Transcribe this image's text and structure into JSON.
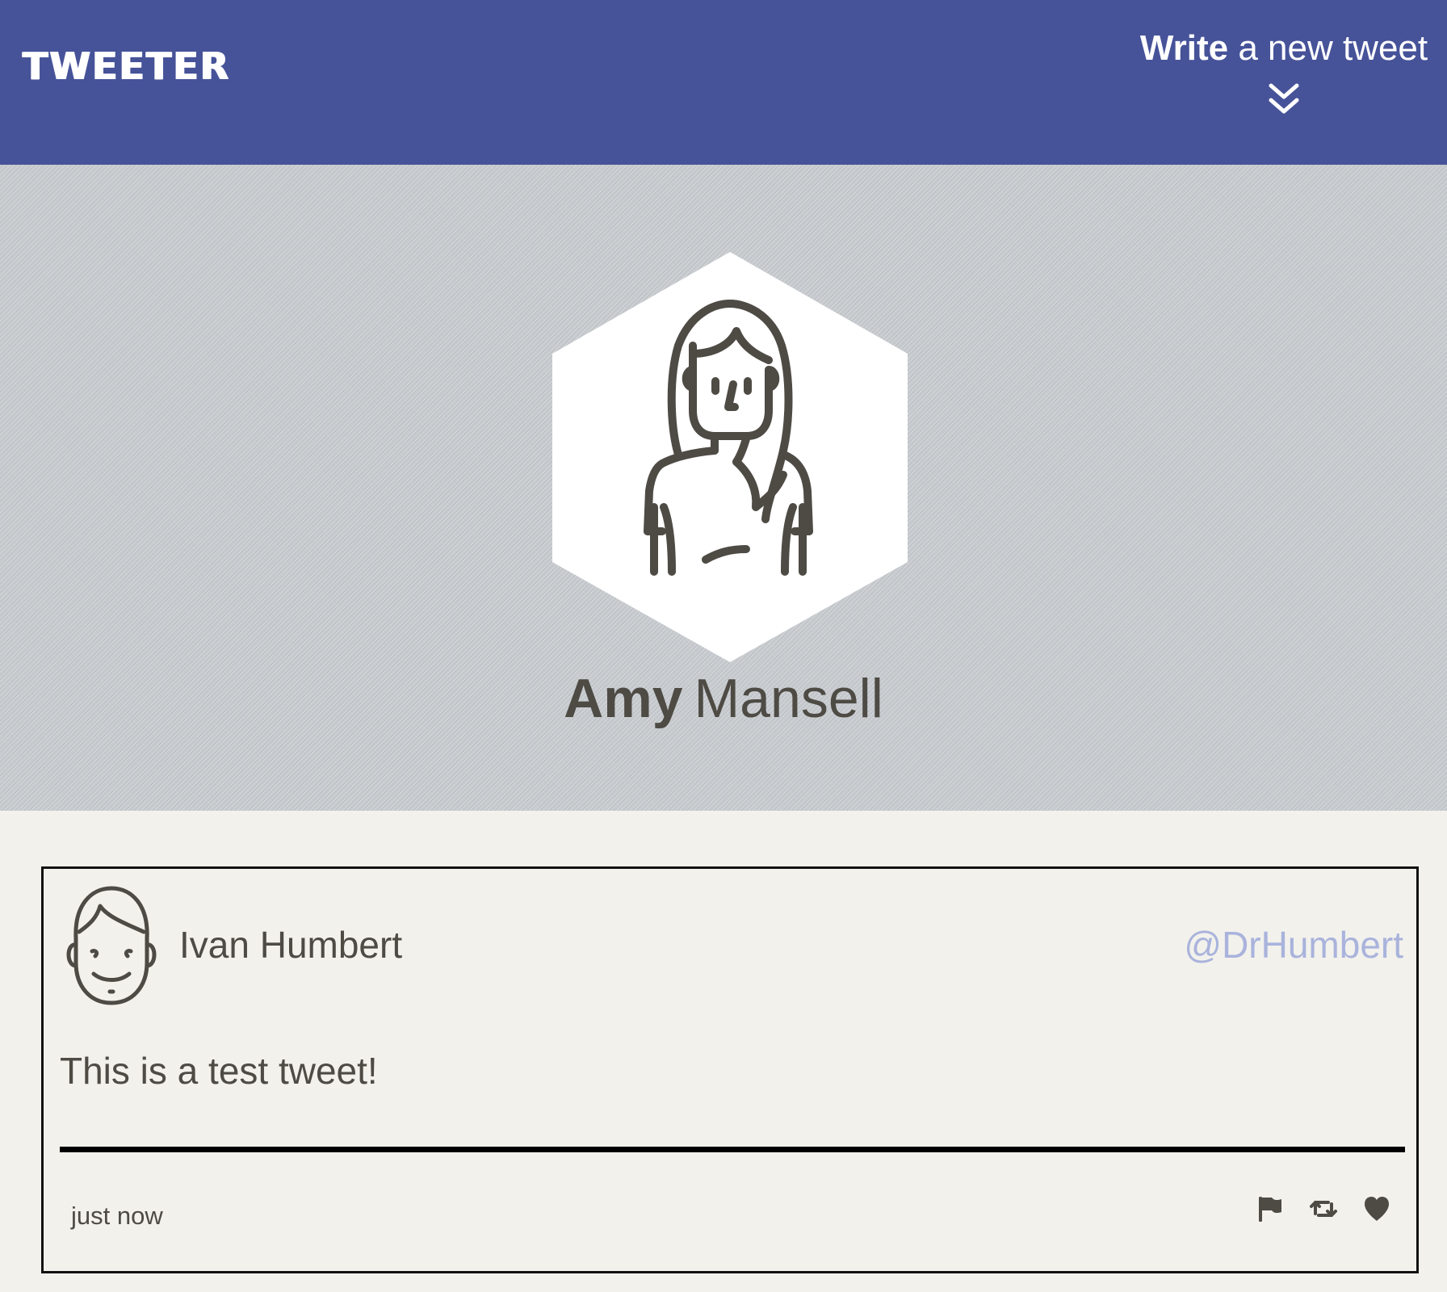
{
  "header": {
    "logo": "TWEETER",
    "compose_strong": "Write",
    "compose_rest": "a new tweet",
    "compose_icon": "double-chevron-down-icon"
  },
  "profile": {
    "first_name": "Amy",
    "last_name": "Mansell",
    "avatar_icon": "female-user-avatar-icon"
  },
  "tweet": {
    "author_name": "Ivan Humbert",
    "handle": "@DrHumbert",
    "text": "This is a test tweet!",
    "timestamp": "just now",
    "avatar_icon": "male-user-avatar-icon",
    "actions": [
      {
        "name": "flag",
        "icon": "flag-icon"
      },
      {
        "name": "retweet",
        "icon": "retweet-icon"
      },
      {
        "name": "like",
        "icon": "heart-icon"
      }
    ]
  },
  "colors": {
    "header_bg": "#465399",
    "banner_bg": "#c9cdd1",
    "page_bg": "#f2f1ec",
    "text": "#4e4b45",
    "handle": "#a9b3dc"
  }
}
